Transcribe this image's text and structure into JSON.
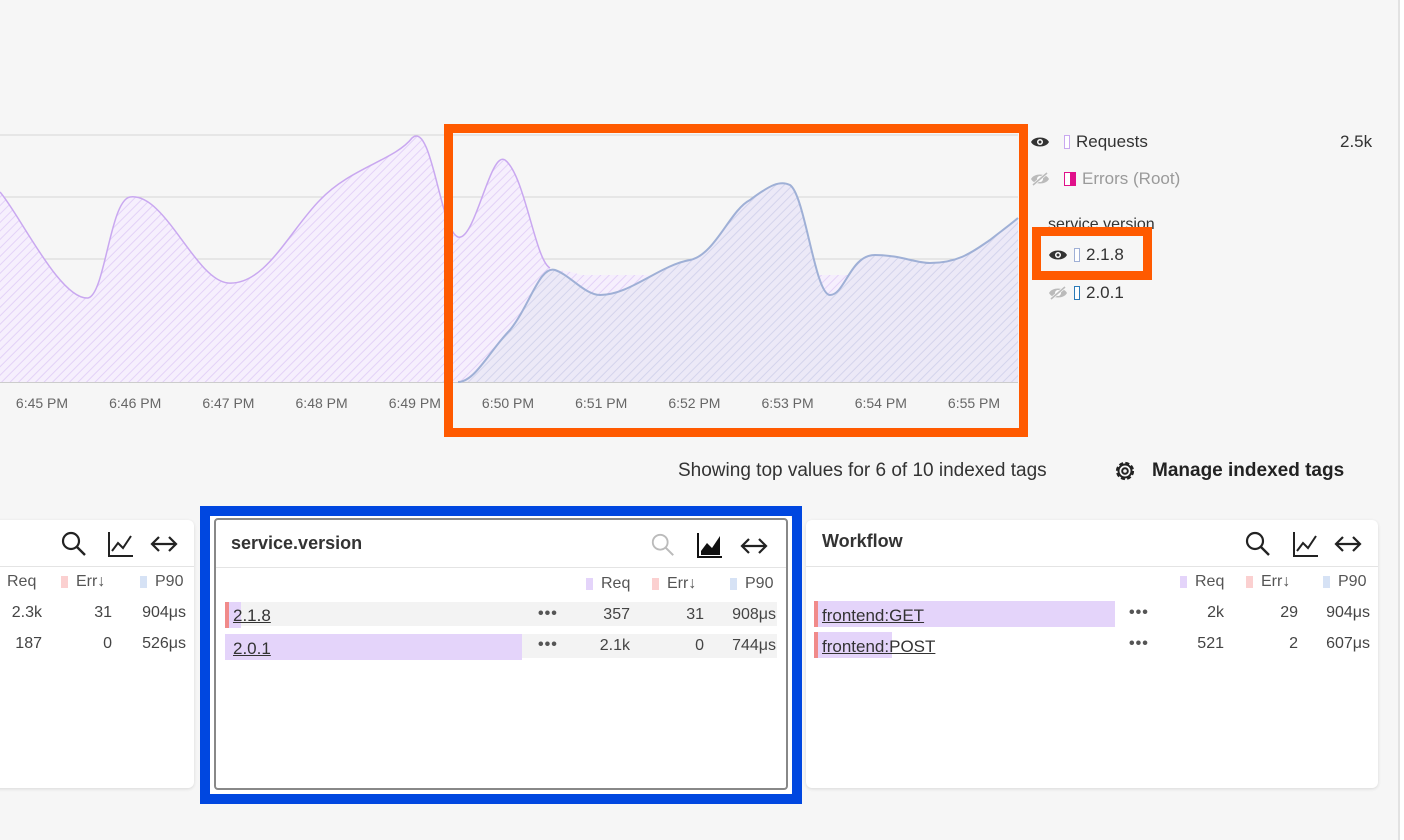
{
  "chart": {
    "x_tick_labels": [
      "6:45 PM",
      "6:46 PM",
      "6:47 PM",
      "6:48 PM",
      "6:49 PM",
      "6:50 PM",
      "6:51 PM",
      "6:52 PM",
      "6:53 PM",
      "6:54 PM",
      "6:55 PM"
    ]
  },
  "chart_data": {
    "type": "area",
    "x": [
      "6:45 PM",
      "6:46 PM",
      "6:47 PM",
      "6:48 PM",
      "6:49 PM",
      "6:50 PM",
      "6:51 PM",
      "6:52 PM",
      "6:53 PM",
      "6:54 PM",
      "6:55 PM"
    ],
    "series": [
      {
        "name": "Requests",
        "color": "#c9a8f0"
      },
      {
        "name": "2.1.8",
        "color": "#b7c4e2"
      }
    ],
    "grid": true,
    "legend": "right"
  },
  "legend": {
    "requests_label": "Requests",
    "requests_value": "2.5k",
    "errors_label": "Errors (Root)",
    "group_title": "service.version",
    "v218_label": "2.1.8",
    "v201_label": "2.0.1"
  },
  "indexed": {
    "showing_text": "Showing top values for 6 of 10 indexed tags",
    "manage_label": "Manage indexed tags"
  },
  "left_card": {
    "cols": {
      "req": "Req",
      "err": "Err↓",
      "p90": "P90"
    },
    "rows": [
      {
        "req": "2.3k",
        "err": "31",
        "p90": "904μs"
      },
      {
        "req": "187",
        "err": "0",
        "p90": "526μs"
      }
    ]
  },
  "version_card": {
    "title": "service.version",
    "cols": {
      "req": "Req",
      "err": "Err↓",
      "p90": "P90"
    },
    "rows": [
      {
        "label": "2.1.8",
        "dots": "•••",
        "req": "357",
        "err": "31",
        "p90": "908μs"
      },
      {
        "label": "2.0.1",
        "dots": "•••",
        "req": "2.1k",
        "err": "0",
        "p90": "744μs"
      }
    ]
  },
  "workflow_card": {
    "title": "Workflow",
    "cols": {
      "req": "Req",
      "err": "Err↓",
      "p90": "P90"
    },
    "rows": [
      {
        "label": "frontend:GET",
        "dots": "•••",
        "req": "2k",
        "err": "29",
        "p90": "904μs"
      },
      {
        "label": "frontend:POST",
        "dots": "•••",
        "req": "521",
        "err": "2",
        "p90": "607μs"
      }
    ]
  },
  "colors": {
    "highlight_orange": "#ff5a00",
    "highlight_blue": "#0047e0",
    "requests": "#c9a8f0",
    "version_218": "#b7c4e2",
    "error_accent": "#f08a8a",
    "bar_fill": "#e4d4fa"
  }
}
